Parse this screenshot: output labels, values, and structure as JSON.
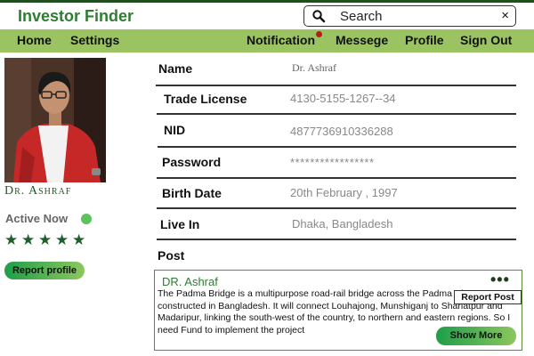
{
  "app": {
    "title": "Investor Finder"
  },
  "search": {
    "text": "Search",
    "close": "×"
  },
  "nav": {
    "home": "Home",
    "settings": "Settings",
    "notification": "Notification",
    "message": "Messege",
    "profile": "Profile",
    "signout": "Sign Out"
  },
  "profile": {
    "name": "Dr. Ashraf",
    "status": "Active Now",
    "rating": 5,
    "report_label": "Report profile"
  },
  "details": {
    "name": {
      "label": "Name",
      "value": "Dr. Ashraf"
    },
    "trade_license": {
      "label": "Trade License",
      "value": "4130-5155-1267--34"
    },
    "nid": {
      "label": "NID",
      "value": "4877736910336288"
    },
    "password": {
      "label": "Password",
      "value": "*****************"
    },
    "birth_date": {
      "label": "Birth Date",
      "value": "20th February , 1997"
    },
    "live_in": {
      "label": "Live In",
      "value": "Dhaka, Bangladesh"
    }
  },
  "post": {
    "heading": "Post",
    "author": "DR. Ashraf",
    "menu": "•••",
    "report_label": "Report Post",
    "body": "The Padma Bridge is a multipurpose road-rail bridge across the Padma River constructed in Bangladesh. It will connect Louhajong, Munshiganj to Shariatpur and Madaripur, linking the south-west of the country, to northern and eastern regions. So I need Fund to implement the project",
    "show_more": "Show More"
  },
  "colors": {
    "nav_bar": "#9bc361",
    "brand_green": "#2e7d32",
    "button_gradient_start": "#1f9e49",
    "button_gradient_end": "#8cc75f",
    "active_dot": "#5cc25c",
    "notification_dot": "#b71c1c"
  },
  "icons": {
    "search": "search-icon",
    "close": "close-icon",
    "star": "star-icon",
    "more": "more-dots-icon"
  }
}
